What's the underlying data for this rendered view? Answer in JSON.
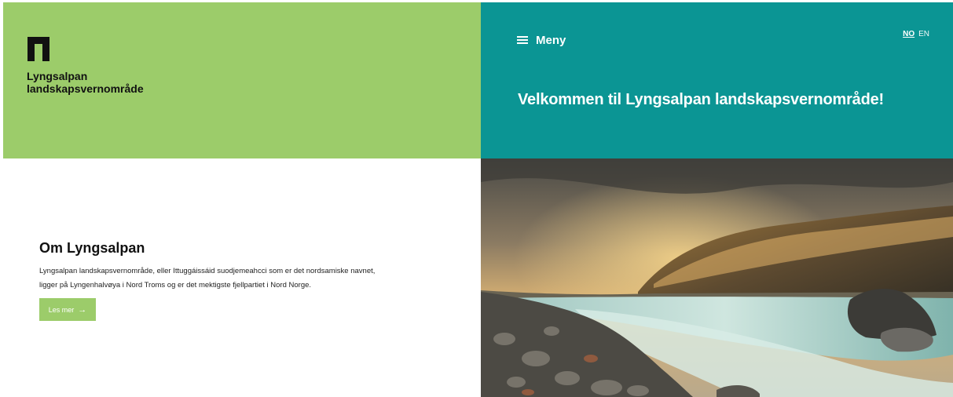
{
  "header": {
    "site_name_line1": "Lyngsalpan",
    "site_name_line2": "landskapsvernområde",
    "menu_label": "Meny",
    "lang_no": "NO",
    "lang_en": "EN"
  },
  "hero": {
    "title": "Velkommen til Lyngsalpan landskapsvernområde!"
  },
  "about": {
    "title": "Om Lyngsalpan",
    "text_line1": "Lyngsalpan landskapsvernområde, eller Ittuggáissáid suodjemeahcci som er det nordsamiske navnet,",
    "text_line2": "ligger på Lyngenhalvøya i Nord Troms og er det mektigste fjellpartiet i Nord Norge.",
    "button_label": "Les mer",
    "button_arrow": "→"
  },
  "colors": {
    "green": "#9ccc6a",
    "teal": "#0b9594"
  },
  "icons": [
    "logo-mark-icon",
    "hamburger-menu-icon",
    "arrow-right-icon"
  ]
}
